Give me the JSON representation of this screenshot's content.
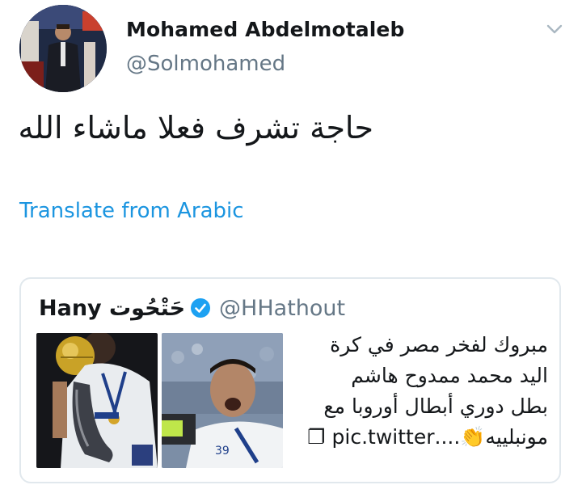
{
  "tweet": {
    "author_name": "Mohamed Abdelmotaleb",
    "author_handle": "@Solmohamed",
    "text": "حاجة تشرف فعلا ماشاء الله",
    "translate_label": "Translate from Arabic"
  },
  "quoted": {
    "name": "Hany حَتْحُوت",
    "handle": "@HHathout",
    "text_lines": [
      "مبروك لفخر مصر في كرة",
      "اليد محمد ممدوح هاشم",
      "بطل دوري أبطال أوروبا مع",
      "مونبلييه👏....pic.twitter ❐"
    ]
  },
  "icons": {
    "menu": "chevron-down-icon",
    "verified": "verified-badge-icon",
    "link_symbol": "❐"
  },
  "colors": {
    "link": "#1b95e0",
    "handle": "#657786",
    "verified": "#1da1f2",
    "border": "#e1e8ed"
  }
}
